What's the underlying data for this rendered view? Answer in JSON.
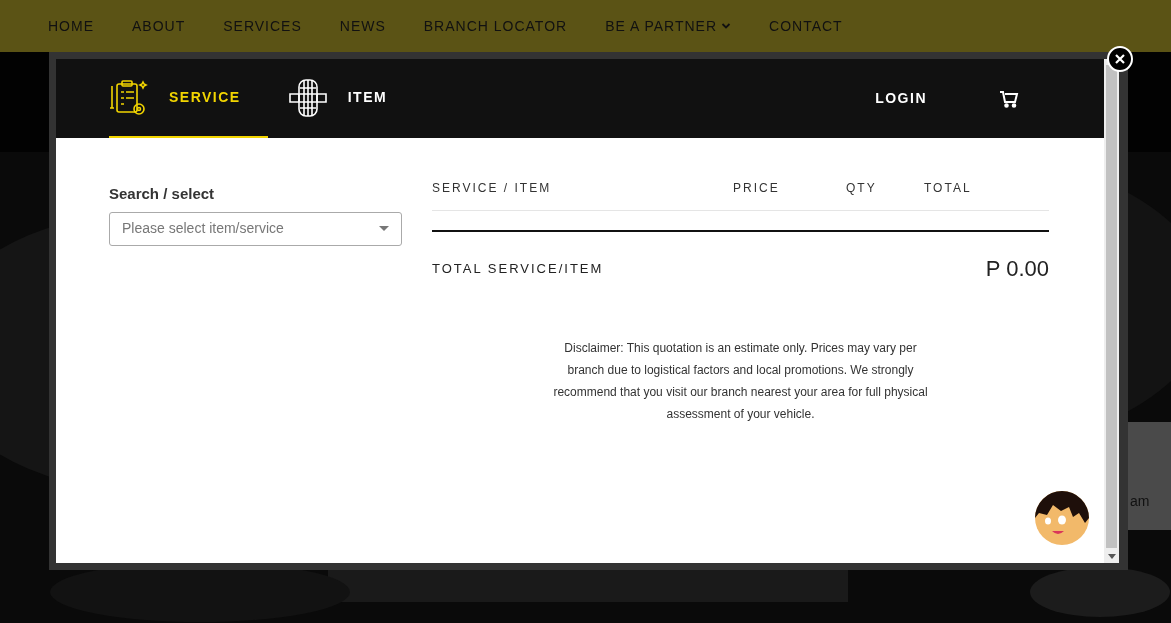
{
  "nav": {
    "items": [
      {
        "label": "HOME",
        "has_menu": false
      },
      {
        "label": "ABOUT",
        "has_menu": false
      },
      {
        "label": "SERVICES",
        "has_menu": false
      },
      {
        "label": "NEWS",
        "has_menu": false
      },
      {
        "label": "BRANCH LOCATOR",
        "has_menu": false
      },
      {
        "label": "BE A PARTNER",
        "has_menu": true
      },
      {
        "label": "CONTACT",
        "has_menu": false
      }
    ]
  },
  "background": {
    "side_text": "am"
  },
  "modal": {
    "tabs": [
      {
        "label": "SERVICE",
        "kind": "clipboard",
        "selected": true
      },
      {
        "label": "ITEM",
        "kind": "tire",
        "selected": false
      }
    ],
    "login": "LOGIN",
    "search": {
      "label": "Search / select",
      "placeholder": "Please select item/service"
    },
    "table": {
      "columns": [
        "SERVICE / ITEM",
        "PRICE",
        "QTY",
        "TOTAL"
      ]
    },
    "total": {
      "label": "TOTAL SERVICE/ITEM",
      "value": "P 0.00"
    },
    "disclaimer": "Disclaimer: This quotation is an estimate only. Prices may vary per branch due to logistical factors and local promotions. We strongly recommend that you visit our branch nearest your area for full physical assessment of your vehicle."
  }
}
